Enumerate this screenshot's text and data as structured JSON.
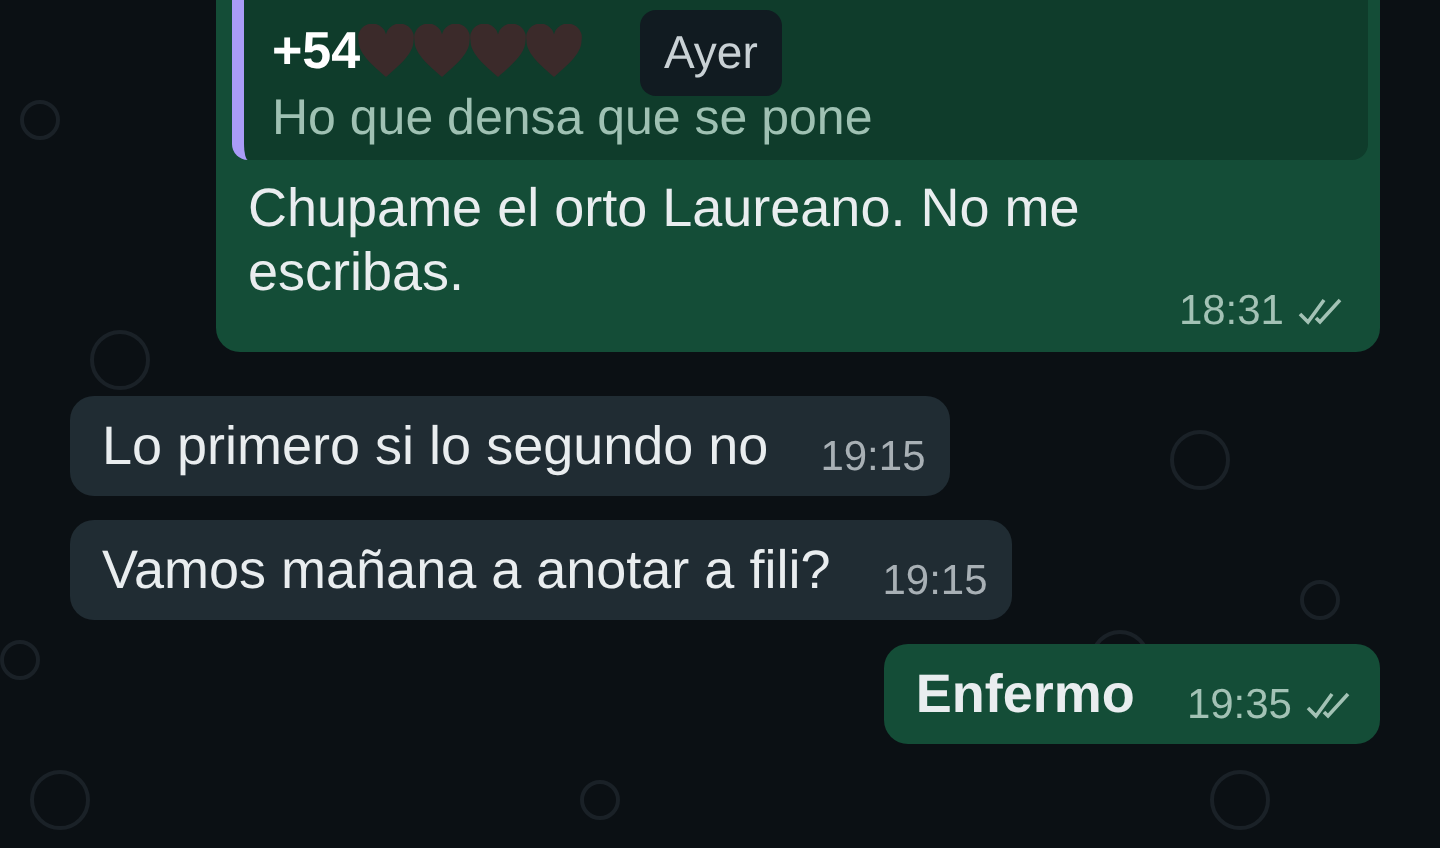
{
  "date_chip": "Ayer",
  "messages": [
    {
      "kind": "outgoing",
      "quote": {
        "sender": "+54",
        "text": "Ho que densa que se pone"
      },
      "text": "Chupame el orto Laureano. No me escribas.",
      "time": "18:31",
      "read": false
    },
    {
      "kind": "incoming",
      "text": "Lo primero si lo segundo no",
      "time": "19:15"
    },
    {
      "kind": "incoming",
      "text": "Vamos mañana a anotar a fili?",
      "time": "19:15"
    },
    {
      "kind": "outgoing",
      "text": "Enfermo",
      "time": "19:35",
      "read": false,
      "bold": true
    }
  ]
}
